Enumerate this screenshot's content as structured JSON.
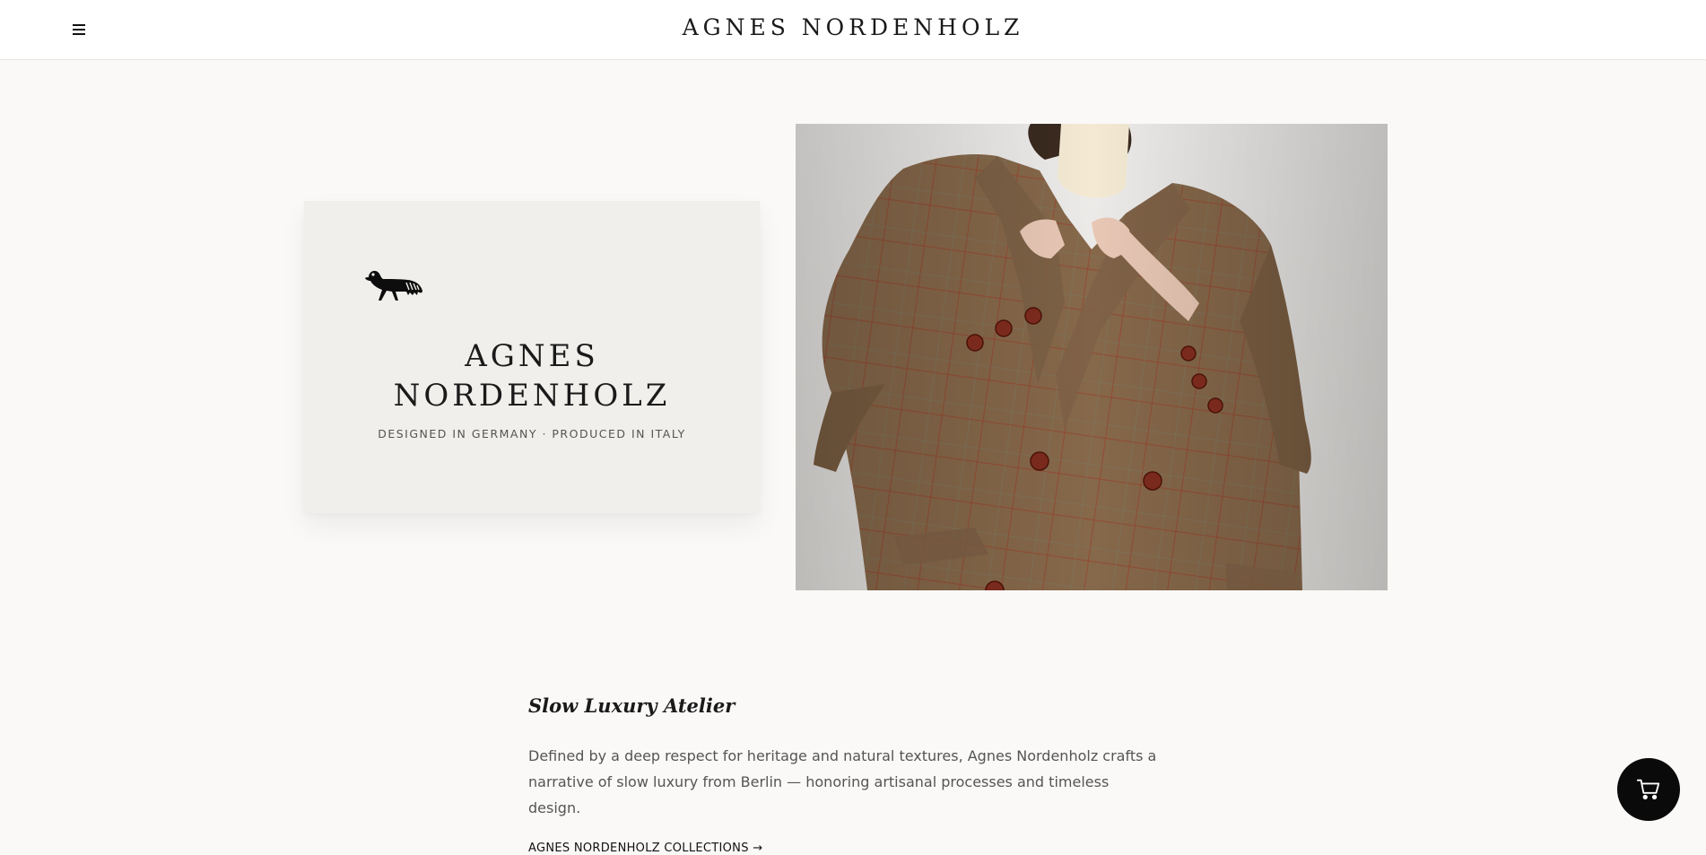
{
  "header": {
    "brand": "AGNES NORDENHOLZ",
    "menu_icon": "hamburger-menu-icon"
  },
  "logo_card": {
    "icon": "horse-logo-icon",
    "title_line1": "AGNES",
    "title_line2": "NORDENHOLZ",
    "subtitle": "DESIGNED IN GERMANY · PRODUCED IN ITALY"
  },
  "hero": {
    "image": "model-in-brown-tweed-blazer-photo"
  },
  "story": {
    "heading": "Slow Luxury Atelier",
    "body": "Defined by a deep respect for heritage and natural textures, Agnes Nordenholz crafts a narrative of slow luxury from Berlin — honoring artisanal processes and timeless design.",
    "link": "AGNES NORDENHOLZ COLLECTIONS →"
  },
  "cart": {
    "icon": "shopping-cart-icon"
  },
  "colors": {
    "page_background": "#faf9f7",
    "card_background": "#f0efeb",
    "cart_button": "#0a0a0a",
    "tweed_brown": "#86684a"
  }
}
